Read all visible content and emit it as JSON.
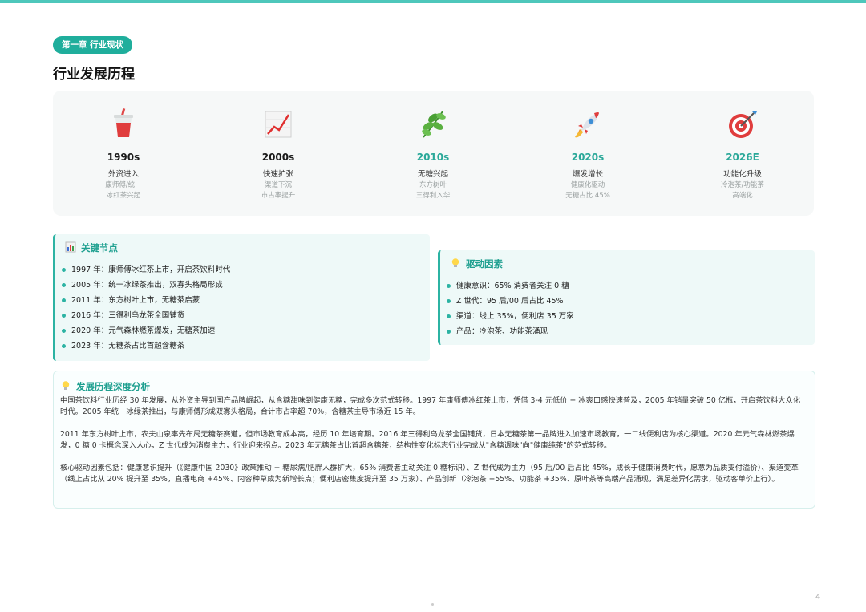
{
  "colors": {
    "accent": "#1fae9c",
    "accent_light": "#eef9f8",
    "top_bar": "#4ec7bb"
  },
  "chapter_tag": "第一章 行业现状",
  "page_title": "行业发展历程",
  "timeline": [
    {
      "icon": "drink-cup-icon",
      "year": "1990s",
      "name": "外资进入",
      "desc1": "康师傅/统一",
      "desc2": "冰红茶兴起"
    },
    {
      "icon": "chart-increasing-icon",
      "year": "2000s",
      "name": "快速扩张",
      "desc1": "渠道下沉",
      "desc2": "市占率提升"
    },
    {
      "icon": "herb-leaf-icon",
      "year": "2010s",
      "name": "无糖兴起",
      "desc1": "东方树叶",
      "desc2": "三得利入华"
    },
    {
      "icon": "rocket-icon",
      "year": "2020s",
      "name": "爆发增长",
      "desc1": "健康化驱动",
      "desc2": "无糖占比 45%"
    },
    {
      "icon": "target-icon",
      "year": "2026E",
      "name": "功能化升级",
      "desc1": "冷泡茶/功能茶",
      "desc2": "高端化"
    }
  ],
  "key_nodes": {
    "title": "关键节点",
    "icon": "bar-chart-icon",
    "items": [
      "1997 年：康师傅冰红茶上市，开启茶饮料时代",
      "2005 年：统一冰绿茶推出，双寡头格局形成",
      "2011 年：东方树叶上市，无糖茶启蒙",
      "2016 年：三得利乌龙茶全国铺货",
      "2020 年：元气森林燃茶爆发，无糖茶加速",
      "2023 年：无糖茶占比首超含糖茶"
    ]
  },
  "drivers": {
    "title": "驱动因素",
    "icon": "lightbulb-icon",
    "items": [
      "健康意识：65% 消费者关注 0 糖",
      "Z 世代：95 后/00 后占比 45%",
      "渠道：线上 35%，便利店 35 万家",
      "产品：冷泡茶、功能茶涌现"
    ]
  },
  "analysis": {
    "title": "发展历程深度分析",
    "icon": "lightbulb-icon",
    "paragraphs": [
      "中国茶饮料行业历经 30 年发展，从外资主导到国产品牌崛起，从含糖甜味到健康无糖，完成多次范式转移。1997 年康师傅冰红茶上市，凭借 3-4 元低价 + 冰爽口感快速普及，2005 年销量突破 50 亿瓶，开启茶饮料大众化时代。2005 年统一冰绿茶推出，与康师傅形成双寡头格局，合计市占率超 70%，含糖茶主导市场近 15 年。",
      "2011 年东方树叶上市，农夫山泉率先布局无糖茶赛道，但市场教育成本高，经历 10 年培育期。2016 年三得利乌龙茶全国铺货，日本无糖茶第一品牌进入加速市场教育，一二线便利店为核心渠道。2020 年元气森林燃茶爆发，0 糖 0 卡概念深入人心，Z 世代成为消费主力，行业迎来拐点。2023 年无糖茶占比首超含糖茶，结构性变化标志行业完成从\"含糖调味\"向\"健康纯茶\"的范式转移。",
      "核心驱动因素包括：健康意识提升（《健康中国 2030》政策推动 + 糖尿病/肥胖人群扩大，65% 消费者主动关注 0 糖标识）、Z 世代成为主力（95 后/00 后占比 45%，成长于健康消费时代，愿意为品质支付溢价）、渠道变革（线上占比从 20% 提升至 35%，直播电商 +45%、内容种草成为新增长点；便利店密集度提升至 35 万家）、产品创新（冷泡茶 +55%、功能茶 +35%、原叶茶等高端产品涌现，满足差异化需求，驱动客单价上行）。"
    ]
  },
  "page_number": "4"
}
